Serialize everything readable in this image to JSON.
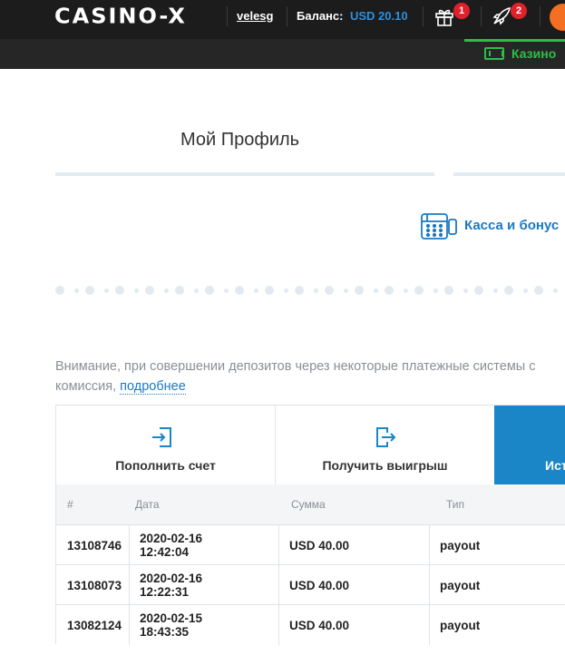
{
  "header": {
    "logo": "CASINO-X",
    "username": "velesg",
    "balance_label": "Баланс:",
    "balance_value": "USD 20.10",
    "gifts_badge": "1",
    "notifications_badge": "2",
    "icons": [
      "gift-icon",
      "rocket-icon",
      "avatar"
    ]
  },
  "subnav": {
    "casino_label": "Казино",
    "icon": "slot-machine-icon",
    "accent_color": "#2bbf4a"
  },
  "profile": {
    "title": "Мой Профиль",
    "kassa_label": "Касса и бонус"
  },
  "notice": {
    "line1": "Внимание, при совершении депозитов через некоторые платежные системы с",
    "line2_prefix": "комиссия, ",
    "link": "подробнее"
  },
  "actions": [
    {
      "label": "Пополнить счет",
      "icon": "deposit-icon"
    },
    {
      "label": "Получить выигрыш",
      "icon": "withdraw-icon"
    },
    {
      "label": "Ист",
      "active": true
    }
  ],
  "table": {
    "headers": [
      "#",
      "Дата",
      "Сумма",
      "Тип"
    ],
    "rows": [
      {
        "id": "13108746",
        "date": "2020-02-16\n12:42:04",
        "amount": "USD 40.00",
        "type": "payout"
      },
      {
        "id": "13108073",
        "date": "2020-02-16\n12:22:31",
        "amount": "USD 40.00",
        "type": "payout"
      },
      {
        "id": "13082124",
        "date": "2020-02-15\n18:43:35",
        "amount": "USD 40.00",
        "type": "payout"
      }
    ]
  },
  "colors": {
    "header_bg": "#1c1c1c",
    "accent_blue": "#1a85c7",
    "balance_blue": "#2f8fdc",
    "badge_red": "#e0202a",
    "avatar_orange": "#f36f21"
  }
}
